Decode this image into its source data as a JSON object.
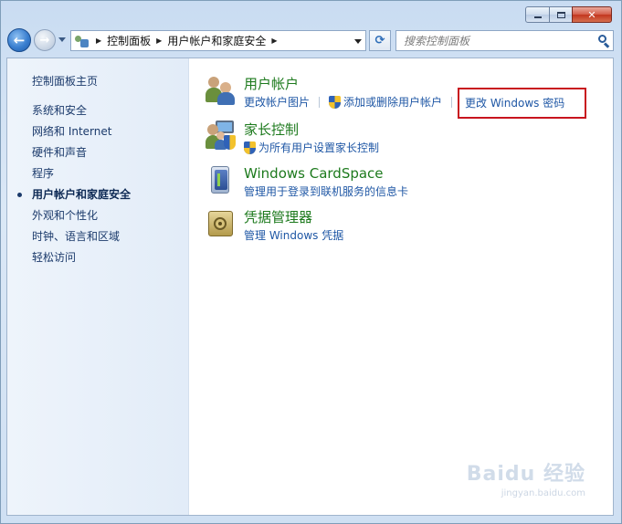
{
  "window": {
    "minimize_label": "",
    "maximize_label": "",
    "close_label": "✕"
  },
  "nav": {
    "back_glyph": "←",
    "forward_glyph": "→",
    "breadcrumb": [
      "控制面板",
      "用户帐户和家庭安全"
    ],
    "refresh_glyph": "⟳"
  },
  "search": {
    "placeholder": "搜索控制面板"
  },
  "sidebar": {
    "home": "控制面板主页",
    "items": [
      {
        "label": "系统和安全",
        "active": false
      },
      {
        "label": "网络和 Internet",
        "active": false
      },
      {
        "label": "硬件和声音",
        "active": false
      },
      {
        "label": "程序",
        "active": false
      },
      {
        "label": "用户帐户和家庭安全",
        "active": true
      },
      {
        "label": "外观和个性化",
        "active": false
      },
      {
        "label": "时钟、语言和区域",
        "active": false
      },
      {
        "label": "轻松访问",
        "active": false
      }
    ]
  },
  "categories": [
    {
      "title": "用户帐户",
      "icon": "users-icon",
      "links": [
        {
          "label": "更改帐户图片",
          "shield": false
        },
        {
          "label": "添加或删除用户帐户",
          "shield": true
        },
        {
          "label": "更改 Windows 密码",
          "shield": false,
          "highlighted": true
        }
      ]
    },
    {
      "title": "家长控制",
      "icon": "parental-controls-icon",
      "links": [
        {
          "label": "为所有用户设置家长控制",
          "shield": true
        }
      ]
    },
    {
      "title": "Windows CardSpace",
      "icon": "cardspace-icon",
      "links": [
        {
          "label": "管理用于登录到联机服务的信息卡",
          "shield": false
        }
      ]
    },
    {
      "title": "凭据管理器",
      "icon": "credential-vault-icon",
      "links": [
        {
          "label": "管理 Windows 凭据",
          "shield": false
        }
      ]
    }
  ],
  "watermark": {
    "logo": "Baidu 经验",
    "sub": "jingyan.baidu.com"
  },
  "colors": {
    "highlight_border": "#c8141e",
    "category_title": "#1d7a1d",
    "link": "#1f57a5"
  }
}
